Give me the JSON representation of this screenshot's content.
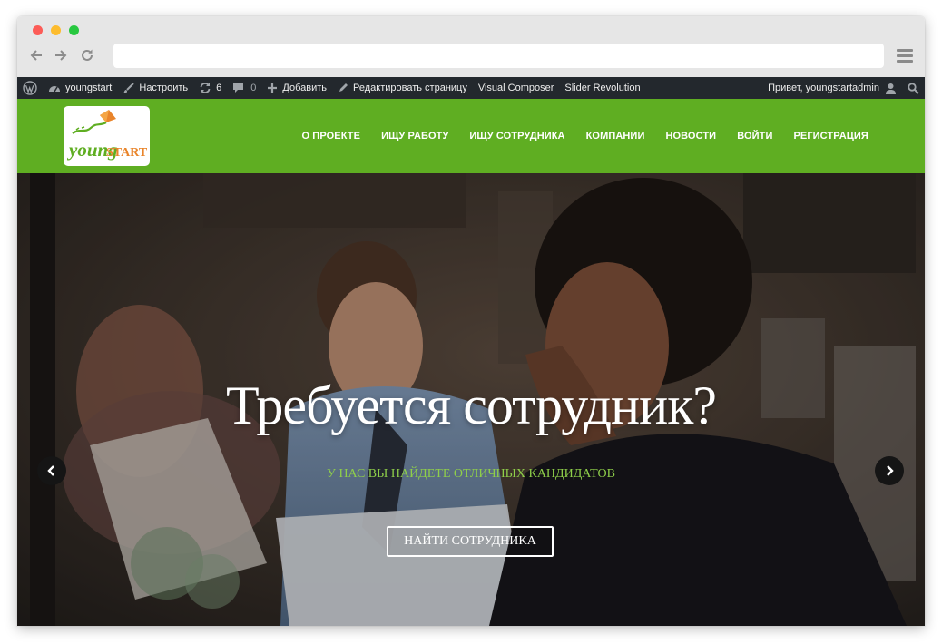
{
  "adminbar": {
    "site_name": "youngstart",
    "customize": "Настроить",
    "updates_count": "6",
    "comments_count": "0",
    "add_new": "Добавить",
    "edit_page": "Редактировать страницу",
    "visual_composer": "Visual Composer",
    "slider_revolution": "Slider Revolution",
    "greeting": "Привет, youngstartadmin"
  },
  "logo": {
    "young": "young",
    "start": "START"
  },
  "nav": {
    "items": [
      "О ПРОЕКТЕ",
      "ИЩУ РАБОТУ",
      "ИЩУ СОТРУДНИКА",
      "КОМПАНИИ",
      "НОВОСТИ",
      "ВОЙТИ",
      "РЕГИСТРАЦИЯ"
    ]
  },
  "hero": {
    "title": "Требуется сотрудник?",
    "subtitle": "У НАС ВЫ НАЙДЕТЕ ОТЛИЧНЫХ КАНДИДАТОВ",
    "button": "НАЙТИ СОТРУДНИКА"
  },
  "colors": {
    "brand_green": "#5fae22",
    "logo_orange": "#e9842a",
    "subtitle_green": "#8fcf4a",
    "adminbar_bg": "#23282d"
  }
}
